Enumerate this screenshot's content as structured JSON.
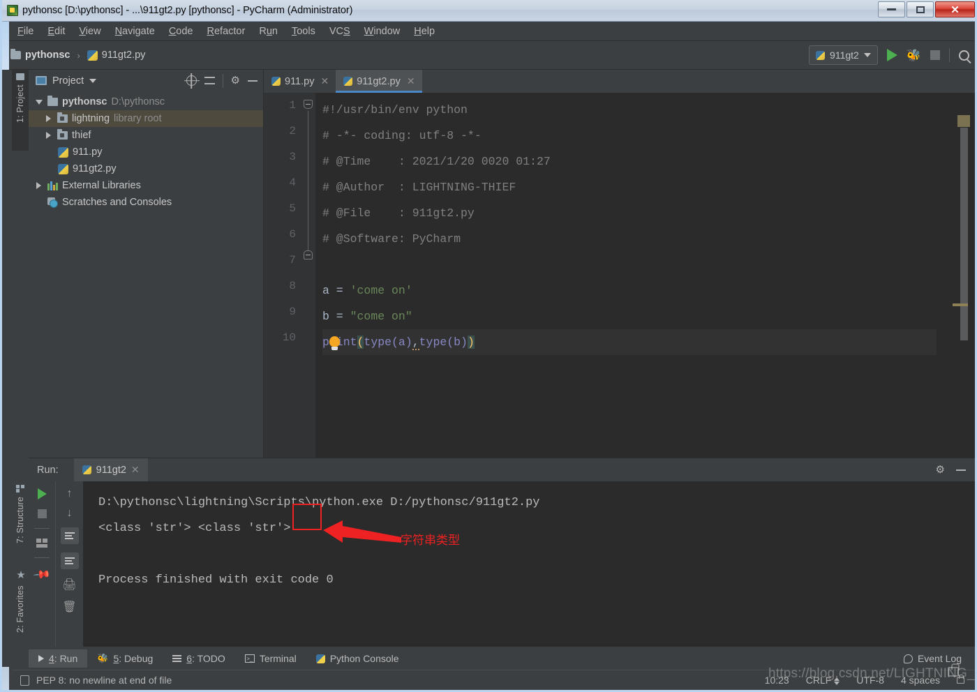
{
  "window": {
    "title": "pythonsc [D:\\pythonsc] - ...\\911gt2.py [pythonsc] - PyCharm (Administrator)",
    "app_icon": "pycharm-icon",
    "minimize": "—",
    "maximize": "□",
    "close": "✕"
  },
  "menubar": {
    "items": [
      {
        "label": "File",
        "mnemonic": "F"
      },
      {
        "label": "Edit",
        "mnemonic": "E"
      },
      {
        "label": "View",
        "mnemonic": "V"
      },
      {
        "label": "Navigate",
        "mnemonic": "N"
      },
      {
        "label": "Code",
        "mnemonic": "C"
      },
      {
        "label": "Refactor",
        "mnemonic": "R"
      },
      {
        "label": "Run",
        "mnemonic": "u"
      },
      {
        "label": "Tools",
        "mnemonic": "T"
      },
      {
        "label": "VCS",
        "mnemonic": "S"
      },
      {
        "label": "Window",
        "mnemonic": "W"
      },
      {
        "label": "Help",
        "mnemonic": "H"
      }
    ]
  },
  "navbar": {
    "breadcrumb": [
      {
        "label": "pythonsc",
        "icon": "folder-icon"
      },
      {
        "label": "911gt2.py",
        "icon": "python-file-icon"
      }
    ],
    "separator": "›",
    "run_config": "911gt2",
    "run_button": "run-icon",
    "debug_button": "debug-icon",
    "stop_button": "stop-icon",
    "search_button": "search-icon"
  },
  "left_tool_tabs": [
    {
      "label": "1: Project",
      "icon": "folder-icon"
    },
    {
      "label": "7: Structure",
      "icon": "structure-icon"
    },
    {
      "label": "2: Favorites",
      "icon": "star-icon"
    }
  ],
  "project_panel": {
    "title": "Project",
    "dropdown": "▾",
    "actions": [
      "locate-icon",
      "collapse-all-icon",
      "gear-icon",
      "hide-icon"
    ],
    "tree": [
      {
        "label": "pythonsc",
        "suffix": "D:\\pythonsc",
        "icon": "folder-icon",
        "twisty": "down",
        "indent": 0,
        "bold": true,
        "selected": false
      },
      {
        "label": "lightning",
        "suffix": "library root",
        "icon": "folder-module-icon",
        "twisty": "right",
        "indent": 1,
        "bold": false,
        "selected": true
      },
      {
        "label": "thief",
        "suffix": "",
        "icon": "folder-module-icon",
        "twisty": "right",
        "indent": 1,
        "bold": false,
        "selected": false
      },
      {
        "label": "911.py",
        "suffix": "",
        "icon": "python-file-icon",
        "twisty": "",
        "indent": 2,
        "bold": false,
        "selected": false
      },
      {
        "label": "911gt2.py",
        "suffix": "",
        "icon": "python-file-icon",
        "twisty": "",
        "indent": 2,
        "bold": false,
        "selected": false
      },
      {
        "label": "External Libraries",
        "suffix": "",
        "icon": "libraries-icon",
        "twisty": "right",
        "indent": 0,
        "bold": false,
        "selected": false
      },
      {
        "label": "Scratches and Consoles",
        "suffix": "",
        "icon": "scratches-icon",
        "twisty": "",
        "indent": 0,
        "bold": false,
        "selected": false
      }
    ]
  },
  "editor": {
    "tabs": [
      {
        "label": "911.py",
        "icon": "python-file-icon",
        "active": false,
        "close": "✕"
      },
      {
        "label": "911gt2.py",
        "icon": "python-file-icon",
        "active": true,
        "close": "✕"
      }
    ],
    "line_numbers": [
      "1",
      "2",
      "3",
      "4",
      "5",
      "6",
      "7",
      "8",
      "9",
      "10"
    ],
    "lines": [
      {
        "n": 1,
        "text": "#!/usr/bin/env python",
        "type": "comment"
      },
      {
        "n": 2,
        "text": "# -*- coding: utf-8 -*-",
        "type": "comment"
      },
      {
        "n": 3,
        "text": "# @Time    : 2021/1/20 0020 01:27",
        "type": "comment"
      },
      {
        "n": 4,
        "text": "# @Author  : LIGHTNING-THIEF",
        "type": "comment"
      },
      {
        "n": 5,
        "text": "# @File    : 911gt2.py",
        "type": "comment"
      },
      {
        "n": 6,
        "text": "# @Software: PyCharm",
        "type": "comment"
      },
      {
        "n": 7,
        "text": "",
        "type": "blank"
      },
      {
        "n": 8,
        "text": "a = 'come on'",
        "type": "code"
      },
      {
        "n": 9,
        "text": "b = \"come on\"",
        "type": "code"
      },
      {
        "n": 10,
        "text": "print(type(a),type(b))",
        "type": "code"
      }
    ],
    "code_tokens": {
      "l8_var": "a",
      "l8_eq": " = ",
      "l8_str": "'come on'",
      "l9_var": "b",
      "l9_eq": " = ",
      "l9_str": "\"come on\"",
      "l10_fn": "print",
      "l10_open": "(",
      "l10_inner1": "type(a)",
      "l10_comma": ",",
      "l10_inner2": "type(b)",
      "l10_close": ")"
    },
    "inspection_hint": "lightbulb-icon"
  },
  "run_panel": {
    "label": "Run:",
    "tab": {
      "label": "911gt2",
      "icon": "python-icon",
      "close": "✕"
    },
    "header_actions": [
      "gear-icon",
      "hide-icon"
    ],
    "tools_left": [
      "rerun-icon",
      "stop-icon",
      "layout-icon",
      "pin-icon"
    ],
    "tools_right": [
      "up-icon",
      "down-icon",
      "soft-wrap-icon",
      "scroll-to-end-icon",
      "print-icon",
      "trash-icon"
    ],
    "console_lines": [
      "D:\\pythonsc\\lightning\\Scripts\\python.exe D:/pythonsc/911gt2.py",
      "<class 'str'> <class 'str'>",
      "",
      "Process finished with exit code 0"
    ]
  },
  "annotation": {
    "highlight_word": "str",
    "text": "字符串类型",
    "color": "#ee2222"
  },
  "bottom_bar": {
    "items": [
      {
        "label": "4: Run",
        "mnemonic": "4",
        "icon": "run-icon",
        "active": true
      },
      {
        "label": "5: Debug",
        "mnemonic": "5",
        "icon": "debug-icon",
        "active": false
      },
      {
        "label": "6: TODO",
        "mnemonic": "6",
        "icon": "todo-icon",
        "active": false
      },
      {
        "label": "Terminal",
        "mnemonic": "",
        "icon": "terminal-icon",
        "active": false
      },
      {
        "label": "Python Console",
        "mnemonic": "",
        "icon": "python-console-icon",
        "active": false
      }
    ],
    "event_log": "Event Log"
  },
  "statusbar": {
    "message": "PEP 8: no newline at end of file",
    "caret_position": "10:23",
    "line_separator": "CRLF",
    "encoding": "UTF-8",
    "indent": "4 spaces",
    "lock_icon": "lock-icon"
  },
  "watermark": {
    "text": "https://blog.csdn.net/LIGHTNING_THIEF"
  },
  "colors": {
    "accent": "#4a88c7",
    "comment": "#808080",
    "string": "#6a8759",
    "function": "#8888c6",
    "plain": "#a9b7c6",
    "editor_bg": "#2b2b2b",
    "panel_bg": "#3c3f41",
    "selection": "#4e4a3e",
    "annotation_red": "#ee2222",
    "run_green": "#4caf50"
  }
}
